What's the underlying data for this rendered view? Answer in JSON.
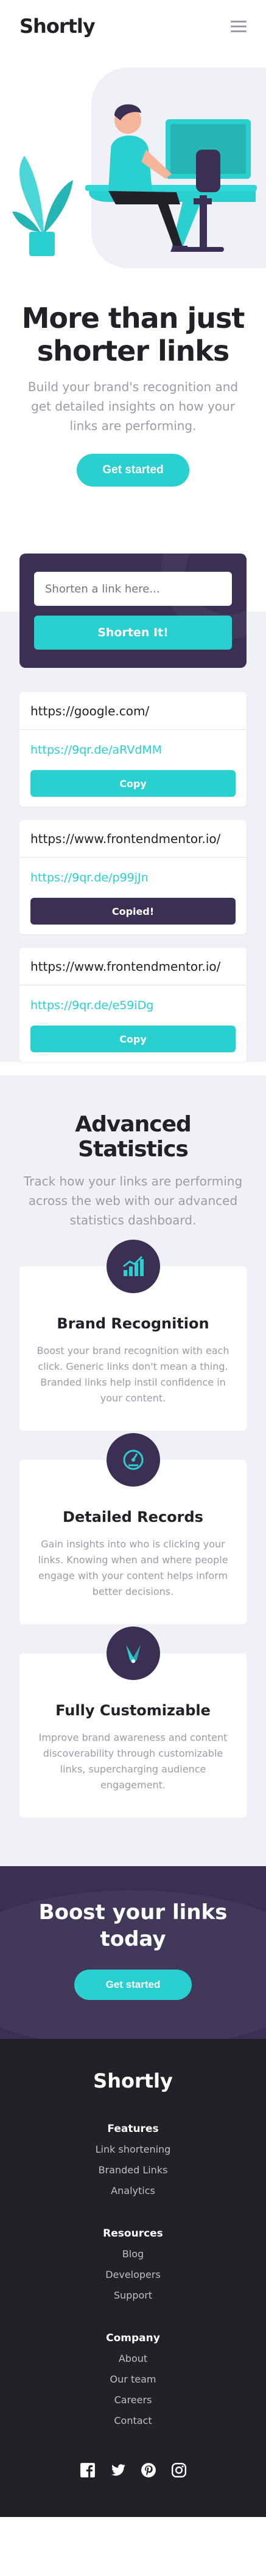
{
  "header": {
    "logo": "Shortly",
    "menu_icon": "hamburger-menu-icon"
  },
  "hero": {
    "title": "More than just shorter links",
    "subtitle": "Build your brand's recognition and get detailed insights on how your links are performing.",
    "cta": "Get started"
  },
  "shorten": {
    "placeholder": "Shorten a link here...",
    "button": "Shorten It!"
  },
  "results": [
    {
      "original": "https://google.com/",
      "short": "https://9qr.de/aRVdMM",
      "button": "Copy"
    },
    {
      "original": "https://www.frontendmentor.io/",
      "short": "https://9qr.de/p99jJn",
      "button": "Copied!"
    },
    {
      "original": "https://www.frontendmentor.io/",
      "short": "https://9qr.de/e59iDg",
      "button": "Copy"
    }
  ],
  "stats": {
    "title": "Advanced Statistics",
    "subtitle": "Track how your links are performing across the web with our advanced statistics dashboard.",
    "cards": [
      {
        "icon": "brand-recognition-chart-icon",
        "title": "Brand Recognition",
        "text": "Boost your brand recognition with each click. Generic links don't mean a thing. Branded links help instil confidence in your content."
      },
      {
        "icon": "detailed-records-gauge-icon",
        "title": "Detailed Records",
        "text": "Gain insights into who is clicking your links. Knowing when and where people engage with your content helps inform better decisions."
      },
      {
        "icon": "fully-customizable-pens-icon",
        "title": "Fully Customizable",
        "text": "Improve brand awareness and content discoverability through customizable links, supercharging audience engagement."
      }
    ]
  },
  "boost": {
    "title": "Boost your links today",
    "cta": "Get started"
  },
  "footer": {
    "logo": "Shortly",
    "columns": [
      {
        "heading": "Features",
        "links": [
          "Link shortening",
          "Branded Links",
          "Analytics"
        ]
      },
      {
        "heading": "Resources",
        "links": [
          "Blog",
          "Developers",
          "Support"
        ]
      },
      {
        "heading": "Company",
        "links": [
          "About",
          "Our team",
          "Careers",
          "Contact"
        ]
      }
    ],
    "socials": [
      "facebook-icon",
      "twitter-icon",
      "pinterest-icon",
      "instagram-icon"
    ]
  },
  "colors": {
    "cyan": "#2acfcf",
    "dark_violet": "#3b3054",
    "very_dark": "#232127",
    "gray": "#9e9aa7",
    "light_bg": "#f0f1f6"
  }
}
